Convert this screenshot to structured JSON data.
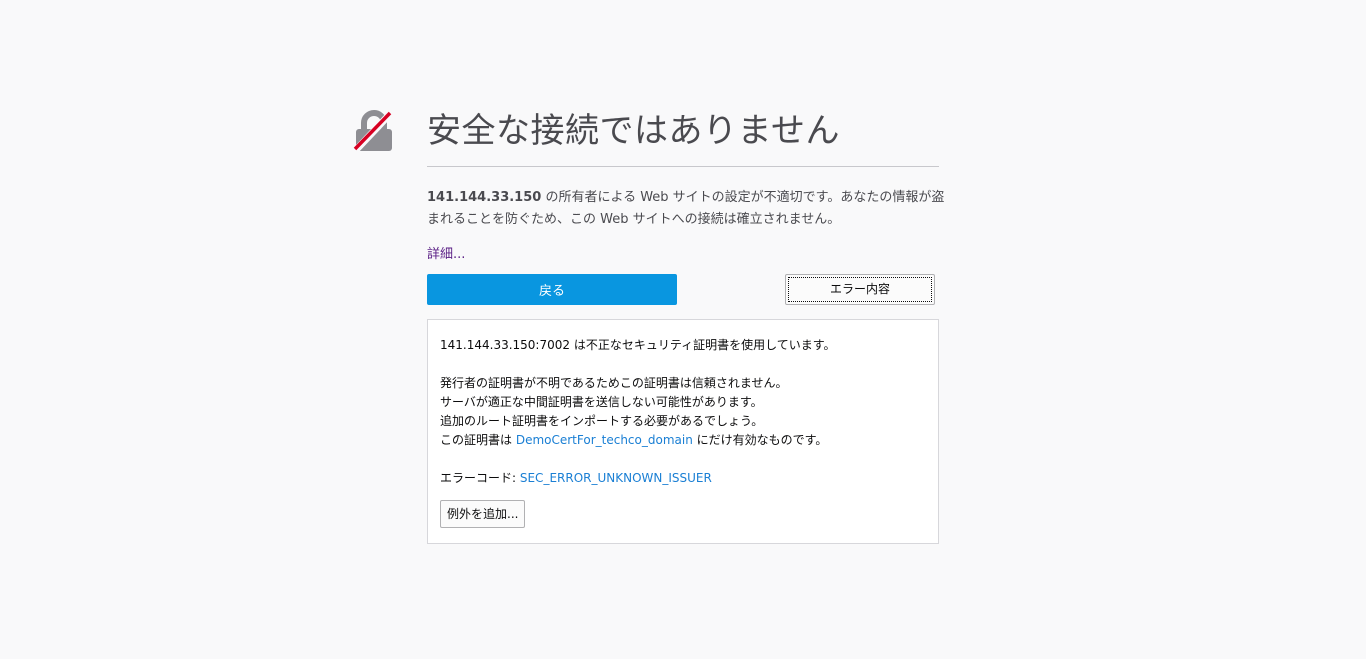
{
  "page": {
    "title": "安全な接続ではありません",
    "description_host": "141.144.33.150",
    "description_rest": " の所有者による Web サイトの設定が不適切です。あなたの情報が盗まれることを防ぐため、この Web サイトへの接続は確立されません。",
    "more_link": "詳細...",
    "lock_icon": "broken-lock-icon"
  },
  "buttons": {
    "back_label": "戻る",
    "details_label": "エラー内容",
    "add_exception_label": "例外を追加..."
  },
  "details": {
    "line1": "141.144.33.150:7002 は不正なセキュリティ証明書を使用しています。",
    "line2": "発行者の証明書が不明であるためこの証明書は信頼されません。",
    "line3": "サーバが適正な中間証明書を送信しない可能性があります。",
    "line4": "追加のルート証明書をインポートする必要があるでしょう。",
    "line5_prefix": "この証明書は ",
    "line5_link": "DemoCertFor_techco_domain",
    "line5_suffix": " にだけ有効なものです。",
    "error_code_label": "エラーコード: ",
    "error_code_value": "SEC_ERROR_UNKNOWN_ISSUER"
  },
  "colors": {
    "primary_button": "#0996e0",
    "link_blue": "#1a7fd4",
    "visited_link": "#5a1f85",
    "lock_gray": "#8e8e93",
    "slash_red": "#d70022"
  }
}
